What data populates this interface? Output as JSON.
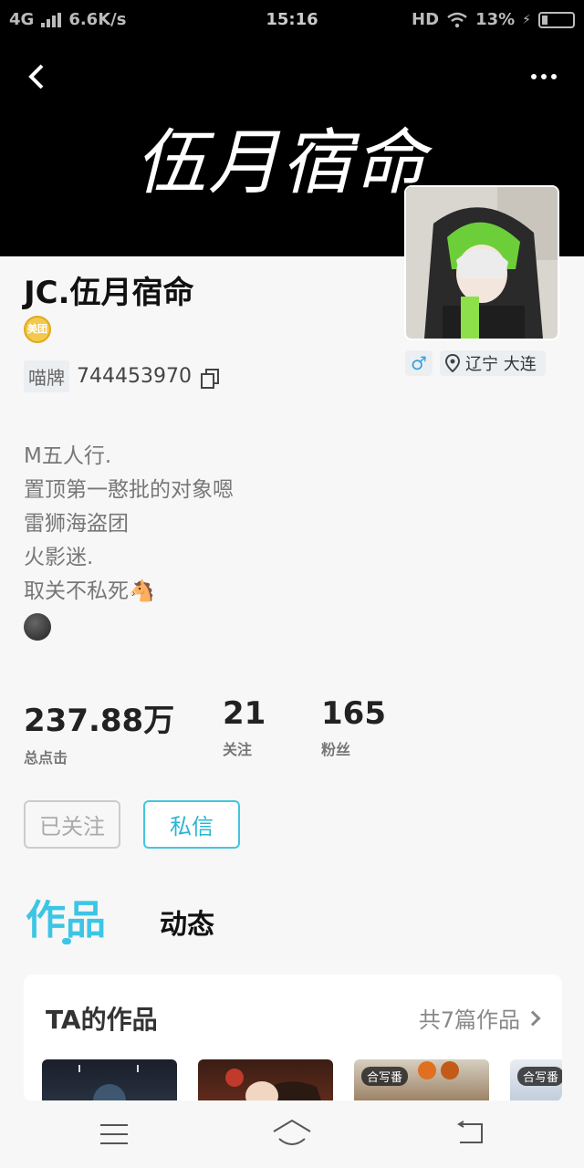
{
  "status_bar": {
    "network": "4G",
    "speed": "6.6K/s",
    "time": "15:16",
    "hd": "HD",
    "battery": "13%"
  },
  "banner": {
    "text": "伍月宿命",
    "back_icon": "chevron-left-icon",
    "more_icon": "more-horizontal-icon"
  },
  "profile": {
    "username": "JC.伍月宿命",
    "badge_text": "美团",
    "id_label": "喵牌",
    "id_value": "744453970",
    "gender_icon": "male-icon",
    "location": "辽宁 大连",
    "bio": [
      "M五人行.",
      "置顶第一憨批的对象嗯",
      "雷狮海盗团",
      "火影迷.",
      "取关不私死🐴"
    ]
  },
  "stats": [
    {
      "value": "237.88万",
      "label": "总点击"
    },
    {
      "value": "21",
      "label": "关注"
    },
    {
      "value": "165",
      "label": "粉丝"
    }
  ],
  "actions": {
    "follow_label": "已关注",
    "message_label": "私信"
  },
  "tabs": {
    "works": "作品",
    "dynamics": "动态"
  },
  "works_section": {
    "title": "TA的作品",
    "count": "共7篇作品",
    "thumb_tags": [
      "合写番",
      "合写番"
    ]
  },
  "colors": {
    "accent": "#3cc5e5",
    "banner_bg": "#000000"
  }
}
